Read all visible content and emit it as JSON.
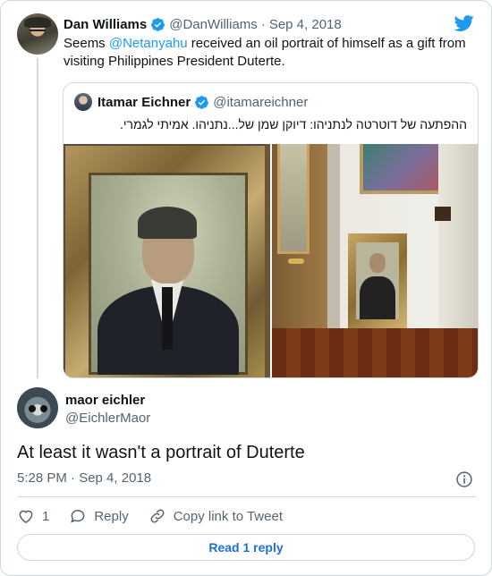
{
  "parent_tweet": {
    "author_name": "Dan Williams",
    "handle": "@DanWilliams",
    "separator": "·",
    "date": "Sep 4, 2018",
    "text_before": "Seems ",
    "mention": "@Netanyahu",
    "text_after": " received an oil portrait of himself as a gift from visiting Philippines President Duterte."
  },
  "quoted_tweet": {
    "author_name": "Itamar Eichner",
    "handle": "@itamareichner",
    "text": "ההפתעה של דוטרטה לנתניהו: דיוקן שמן של...נתניהו.  אמיתי לגמרי."
  },
  "reply_tweet": {
    "author_name": "maor eichler",
    "handle": "@EichlerMaor",
    "text": "At least it wasn't a portrait of Duterte",
    "timestamp": "5:28 PM · Sep 4, 2018"
  },
  "actions": {
    "like_count": "1",
    "reply_label": "Reply",
    "copy_link_label": "Copy link to Tweet"
  },
  "read_replies_label": "Read 1 reply",
  "icons": {
    "brand": "twitter-bird-icon",
    "verified": "verified-badge-icon",
    "info": "info-icon",
    "like": "heart-icon",
    "reply": "speech-bubble-icon",
    "link": "link-icon"
  },
  "colors": {
    "accent": "#1d9bf0",
    "text": "#0f1419",
    "muted": "#536471",
    "border": "#cfd9de",
    "like_icon": "#f4212e"
  }
}
